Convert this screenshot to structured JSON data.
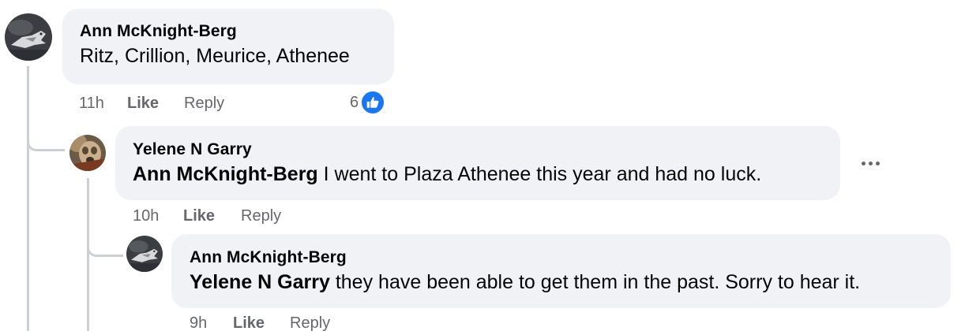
{
  "comments": [
    {
      "author": "Ann McKnight-Berg",
      "mention": "",
      "text": "Ritz, Crillion, Meurice, Athenee",
      "time": "11h",
      "like_label": "Like",
      "reply_label": "Reply",
      "reaction_count": "6",
      "reaction_icon": "thumbs-up-icon",
      "avatar_icon": "avatar-gray-photo"
    },
    {
      "author": "Yelene N Garry",
      "mention": "Ann McKnight-Berg",
      "text": " I went to Plaza Athenee this year and had no luck.",
      "time": "10h",
      "like_label": "Like",
      "reply_label": "Reply",
      "avatar_icon": "avatar-dog-photo"
    },
    {
      "author": "Ann McKnight-Berg",
      "mention": "Yelene N Garry",
      "text": " they have been able to get them in the past. Sorry to hear it.",
      "time": "9h",
      "like_label": "Like",
      "reply_label": "Reply",
      "avatar_icon": "avatar-gray-photo"
    }
  ],
  "colors": {
    "bubble_bg": "#f0f2f5",
    "meta_text": "#65676b",
    "like_blue": "#1877f2",
    "thread_line": "#ccd0d5"
  }
}
